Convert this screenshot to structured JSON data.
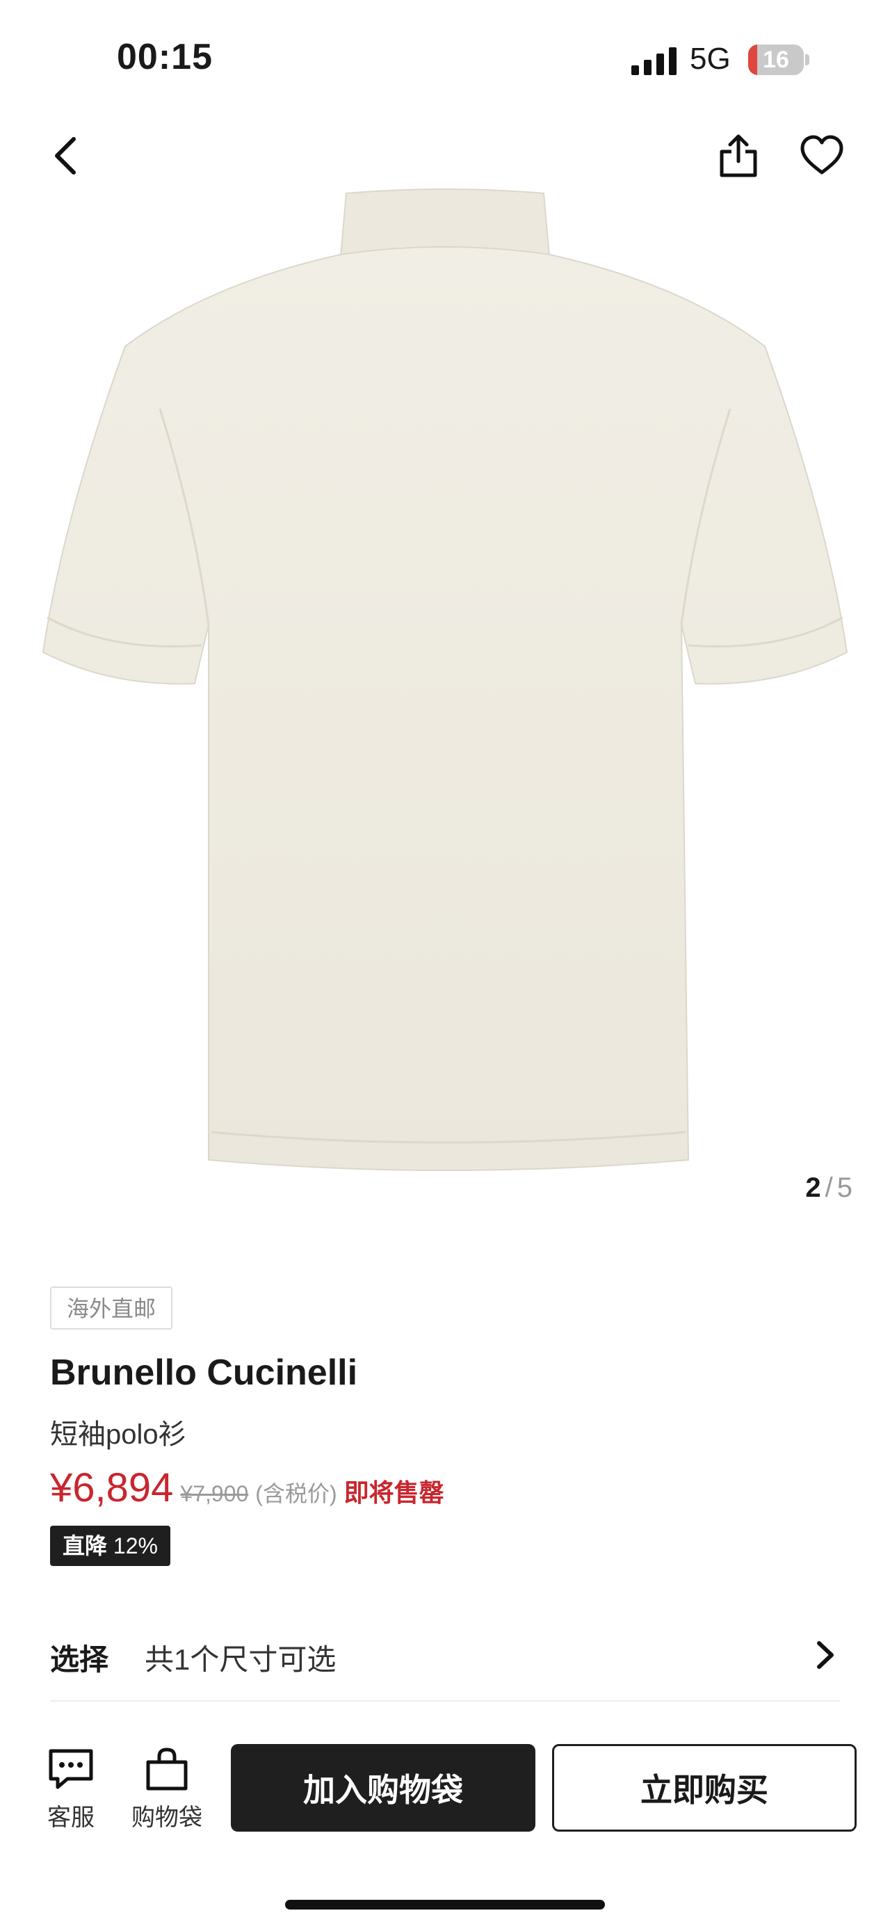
{
  "status_bar": {
    "time": "00:15",
    "network": "5G",
    "battery": "16",
    "battery_level": 0.16
  },
  "nav": {
    "back_icon": "chevron-left-icon",
    "share_icon": "share-icon",
    "favorite_icon": "heart-outline-icon"
  },
  "gallery": {
    "current": "2",
    "separator": "/",
    "total": "5"
  },
  "product": {
    "tag": "海外直邮",
    "brand": "Brunello Cucinelli",
    "name": "短袖polo衫",
    "price": "¥6,894",
    "original_price": "¥7,900",
    "tax_note": "(含税价)",
    "stock_note": "即将售罄",
    "discount_label": "直降",
    "discount_value": "12%"
  },
  "size_select": {
    "label": "选择",
    "value": "共1个尺寸可选"
  },
  "bottom_bar": {
    "service_label": "客服",
    "bag_label": "购物袋",
    "add_to_bag": "加入购物袋",
    "buy_now": "立即购买"
  },
  "colors": {
    "accent_red": "#c8262e",
    "dark": "#1f1f1f",
    "shirt": "#eeeae0"
  }
}
